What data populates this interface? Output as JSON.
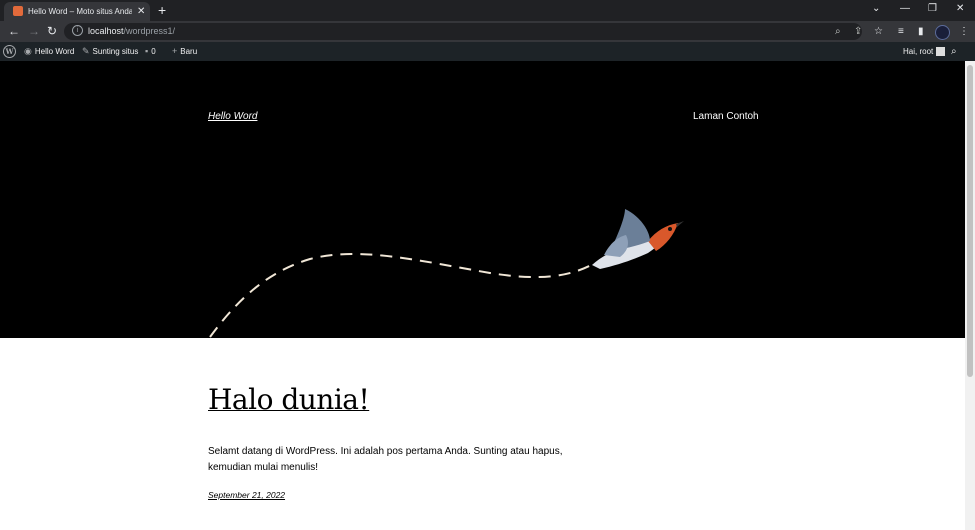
{
  "browser": {
    "tab_title": "Hello Word – Moto situs Anda b",
    "tab_close": "✕",
    "new_tab": "+",
    "url_host": "localhost",
    "url_path": "/wordpress1/",
    "window_controls": [
      "⌄",
      "—",
      "❐",
      "✕"
    ]
  },
  "adminbar": {
    "site_name": "Hello Word",
    "customize": "Sunting situs",
    "comments_count": "0",
    "new_label": "Baru",
    "greeting": "Hai, root"
  },
  "header": {
    "site_title": "Hello Word",
    "nav_item": "Laman Contoh"
  },
  "post": {
    "title": "Halo dunia!",
    "body": "Selamt datang di WordPress. Ini adalah pos pertama Anda. Sunting atau hapus, kemudian mulai menulis!",
    "date": "September 21, 2022"
  },
  "icons": {
    "back": "←",
    "forward": "→",
    "reload": "↻",
    "zoom": "⌕",
    "share": "⇪",
    "star": "☆",
    "media": "≡",
    "sidepanel": "▮",
    "menu": "⋮",
    "comment": "▪",
    "plus": "+",
    "search": "⌕",
    "wrench": "✎",
    "dashboard": "◉"
  }
}
